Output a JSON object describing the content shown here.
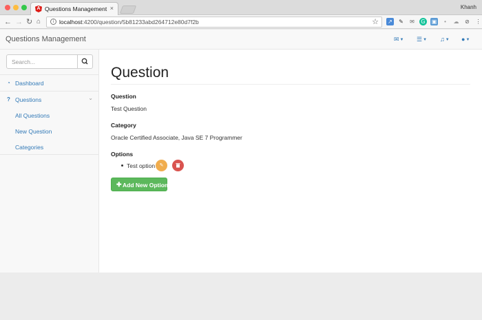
{
  "browser": {
    "tab_title": "Questions Management",
    "tab_close": "×",
    "user_name": "Khanh",
    "url_host": "localhost",
    "url_path": ":4200/question/5b81233abd264712e80d7f2b"
  },
  "navbar": {
    "brand": "Questions Management",
    "icons": [
      "envelope-icon",
      "tasks-icon",
      "bell-icon",
      "user-icon"
    ]
  },
  "sidebar": {
    "search_placeholder": "Search...",
    "items": [
      {
        "label": "Dashboard",
        "icon": "dashboard-icon"
      },
      {
        "label": "Questions",
        "icon": "question-icon"
      },
      {
        "label": "All Questions"
      },
      {
        "label": "New Question"
      },
      {
        "label": "Categories"
      }
    ]
  },
  "main": {
    "title": "Question",
    "question_label": "Question",
    "question_value": "Test Question",
    "category_label": "Category",
    "category_value": "Oracle Certified Associate, Java SE 7 Programmer",
    "options_label": "Options",
    "options": [
      {
        "text": "Test option"
      }
    ],
    "add_option_label": "Add New Option"
  },
  "colors": {
    "link": "#337ab7",
    "success": "#5cb85c",
    "warning": "#f0ad4e",
    "danger": "#d9534f"
  }
}
